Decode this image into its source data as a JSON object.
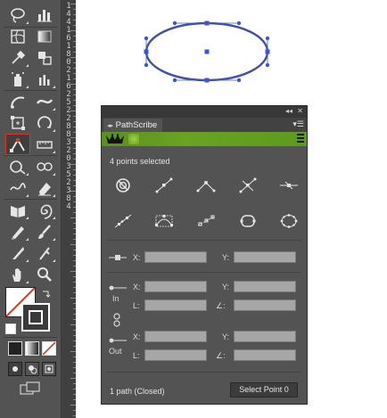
{
  "ruler": {
    "labels": [
      "1",
      "4",
      "4",
      "1",
      "6",
      "1",
      "8",
      "0",
      "2",
      "1",
      "6",
      "2",
      "5",
      "2",
      "2",
      "8",
      "8",
      "3",
      "2",
      "0",
      "3",
      "5",
      "2",
      "3",
      "8",
      "4"
    ]
  },
  "panel": {
    "tab_label": "PathScribe",
    "topbar_collapse": "◂◂",
    "topbar_close": "✕",
    "menu_icon": "menu-icon",
    "brand_icon": "crown-icon",
    "brand_color": "#6aa321",
    "selection_status": "4 points selected",
    "action_row_1": [
      "target-icon",
      "smooth-point-icon",
      "corner-point-icon",
      "convert-point-icon",
      "cusp-point-icon"
    ],
    "action_row_2": [
      "line-segment-icon",
      "bounding-box-icon",
      "dotted-line-icon",
      "ellipse-shape-icon",
      "gear-ring-icon"
    ],
    "point": {
      "x_label": "X:",
      "y_label": "Y:",
      "x_value": "",
      "y_value": ""
    },
    "in": {
      "section_label": "In",
      "x_label": "X:",
      "y_label": "Y:",
      "length_label": "L:",
      "angle_label": "∠:"
    },
    "out": {
      "section_label": "Out",
      "x_label": "X:",
      "y_label": "Y:",
      "length_label": "L:",
      "angle_label": "∠:"
    },
    "path_status": "1 path (Closed)",
    "select_button": "Select Point 0"
  }
}
